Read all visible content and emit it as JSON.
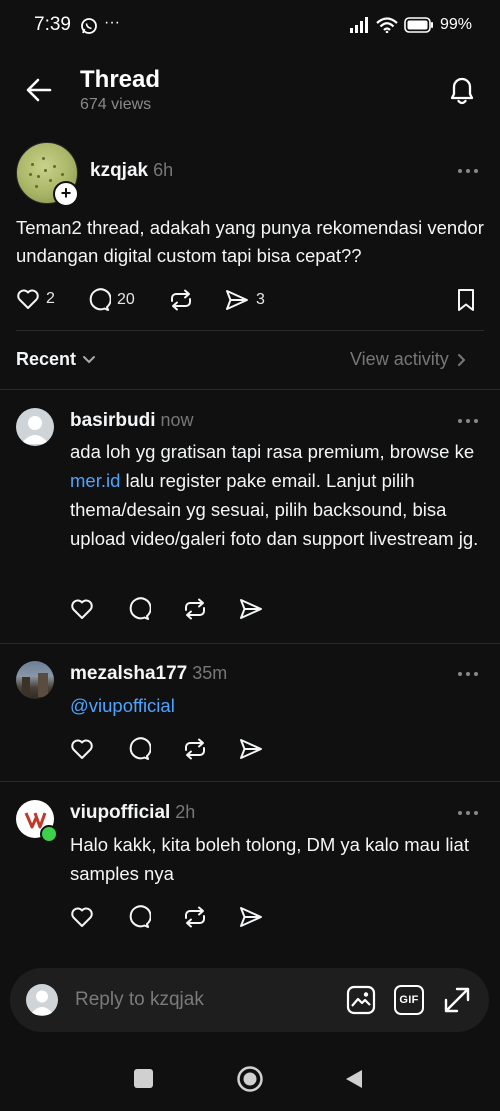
{
  "status_bar": {
    "time": "7:39",
    "battery": "99%"
  },
  "header": {
    "title": "Thread",
    "views": "674 views"
  },
  "post": {
    "username": "kzqjak",
    "time": "6h",
    "text": "Teman2 thread, adakah yang punya rekomendasi vendor undangan digital custom tapi bisa cepat??",
    "likes": "2",
    "replies": "20",
    "shares": "3"
  },
  "sort": {
    "label": "Recent",
    "view_activity": "View activity"
  },
  "replies": [
    {
      "username": "basirbudi",
      "time": "now",
      "text_before": "ada loh yg gratisan tapi rasa premium, browse ke ",
      "link": "mer.id",
      "text_after": " lalu register pake email. Lanjut pilih thema/desain yg sesuai, pilih backsound, bisa upload video/galeri foto dan support livestream jg."
    },
    {
      "username": "mezalsha177",
      "time": "35m",
      "mention": "@viupofficial"
    },
    {
      "username": "viupofficial",
      "time": "2h",
      "text": "Halo kakk, kita boleh tolong, DM ya kalo mau liat samples nya"
    }
  ],
  "composer": {
    "placeholder": "Reply to kzqjak",
    "gif_label": "GIF"
  },
  "colors": {
    "background": "#101010",
    "link": "#4ea3ff",
    "muted": "#777777",
    "online": "#3ecf4c"
  }
}
